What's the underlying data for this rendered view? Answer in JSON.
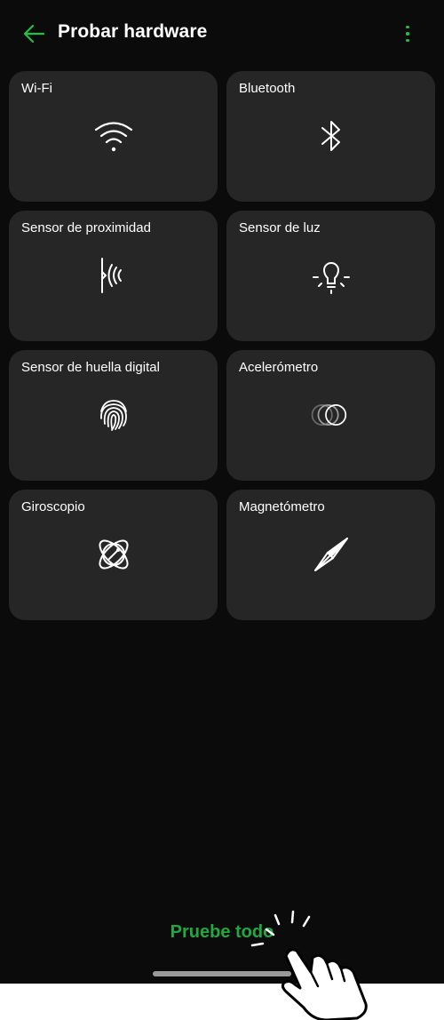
{
  "header": {
    "title": "Probar hardware",
    "back_icon": "arrow-left-icon",
    "menu_icon": "more-vert-icon"
  },
  "tiles": [
    {
      "label": "Wi-Fi",
      "icon": "wifi-icon"
    },
    {
      "label": "Bluetooth",
      "icon": "bluetooth-icon"
    },
    {
      "label": "Sensor de proximidad",
      "icon": "proximity-icon"
    },
    {
      "label": "Sensor de luz",
      "icon": "light-bulb-icon"
    },
    {
      "label": "Sensor de huella digital",
      "icon": "fingerprint-icon"
    },
    {
      "label": "Acelerómetro",
      "icon": "accelerometer-icon"
    },
    {
      "label": "Giroscopio",
      "icon": "gyroscope-icon"
    },
    {
      "label": "Magnetómetro",
      "icon": "compass-icon"
    }
  ],
  "cta": {
    "label": "Pruebe todo"
  },
  "colors": {
    "accent": "#21a83e",
    "background": "#0b0b0b",
    "card": "#262626"
  }
}
